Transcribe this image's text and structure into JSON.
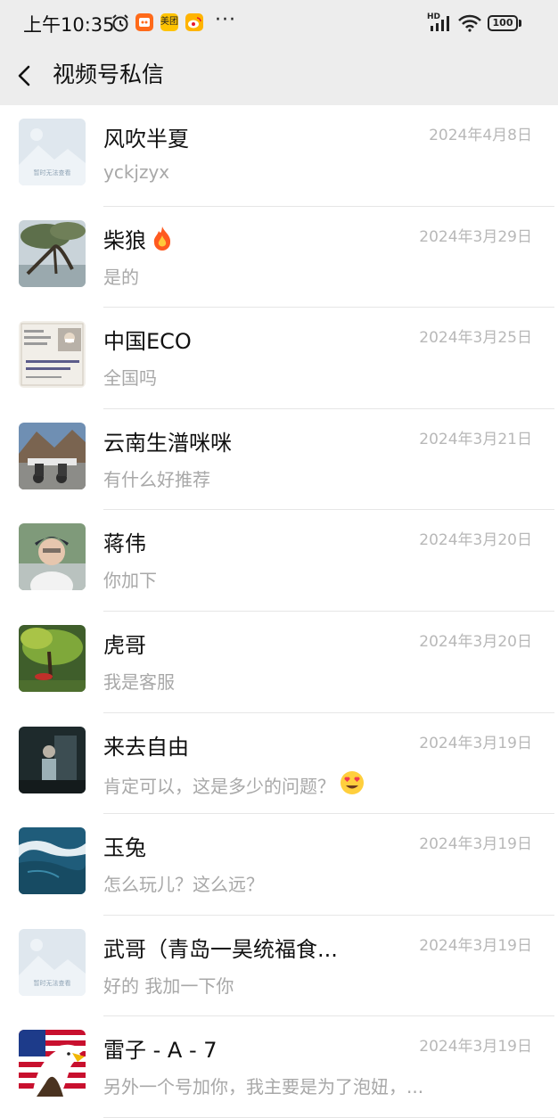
{
  "status_bar": {
    "time": "上午10:35",
    "app_badge_meituan": "美团",
    "hd_label": "HD",
    "battery": "100",
    "more": "···"
  },
  "header": {
    "title": "视频号私信"
  },
  "placeholder_text": "暂时无法查看",
  "emoji": {
    "fire": "fire",
    "heart_eyes": "smiling-face-with-heart-eyes"
  },
  "messages": [
    {
      "name": "风吹半夏",
      "preview": "yckjzyx",
      "date": "2024年4月8日"
    },
    {
      "name": "柴狼",
      "preview": "是的",
      "date": "2024年3月29日"
    },
    {
      "name": "中国ECO",
      "preview": "全国吗",
      "date": "2024年3月25日"
    },
    {
      "name": "云南生潽咪咪",
      "preview": "有什么好推荐",
      "date": "2024年3月21日"
    },
    {
      "name": "蒋伟",
      "preview": "你加下",
      "date": "2024年3月20日"
    },
    {
      "name": "虎哥",
      "preview": "我是客服",
      "date": "2024年3月20日"
    },
    {
      "name": "来去自由",
      "preview": "肯定可以，这是多少的问题？",
      "date": "2024年3月19日"
    },
    {
      "name": "玉兔",
      "preview": "怎么玩儿？这么远？",
      "date": "2024年3月19日"
    },
    {
      "name": "武哥（青岛一昊统福食...",
      "preview": "好的 我加一下你",
      "date": "2024年3月19日"
    },
    {
      "name": "雷子 - A - 7",
      "preview": "另外一个号加你，我主要是为了泡妞，...",
      "date": "2024年3月19日"
    }
  ]
}
